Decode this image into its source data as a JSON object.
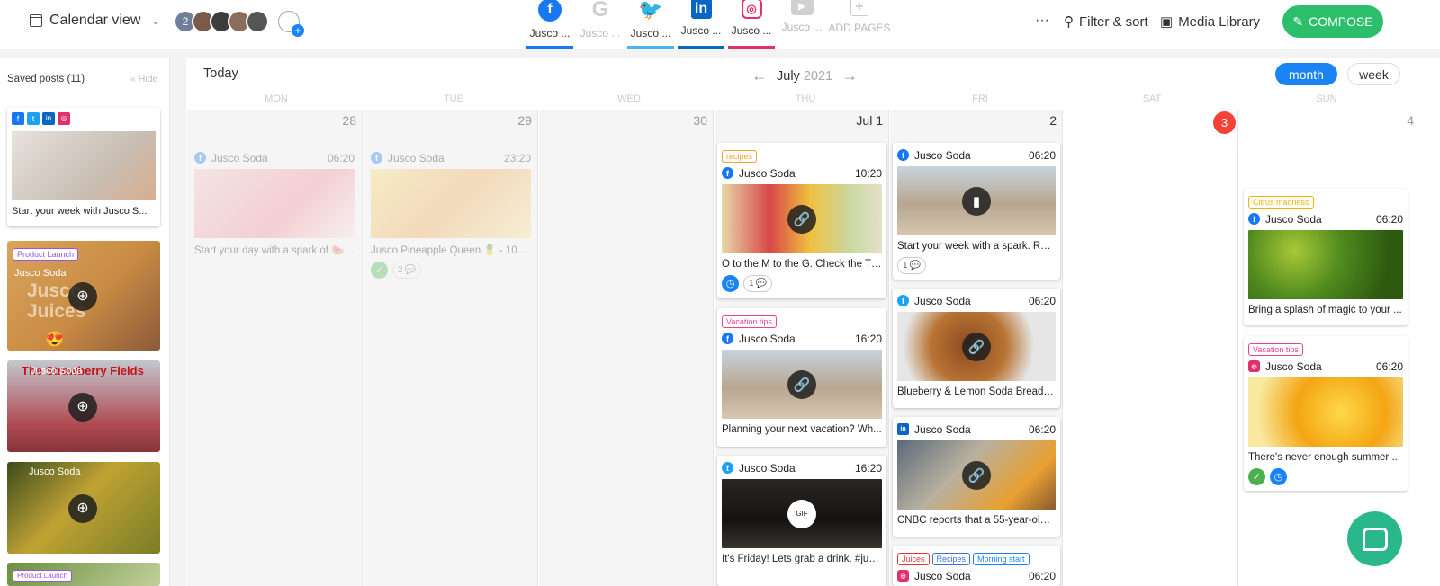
{
  "header": {
    "calendar_view_label": "Calendar view",
    "team_count": "2",
    "tabs": [
      {
        "label": "Jusco ...",
        "icon": "facebook-icon",
        "glyph": "f",
        "color": "#1877f2",
        "active": true,
        "bar": "#1877f2"
      },
      {
        "label": "Jusco ...",
        "icon": "google-icon",
        "glyph": "G",
        "color": "#cfcfcf",
        "active": false,
        "bar": ""
      },
      {
        "label": "Jusco ...",
        "icon": "twitter-icon",
        "glyph": "t",
        "color": "#1da1f2",
        "active": true,
        "bar": "#4fb2f0"
      },
      {
        "label": "Jusco ...",
        "icon": "linkedin-icon",
        "glyph": "in",
        "color": "#0a66c2",
        "active": true,
        "bar": "#0a66c2"
      },
      {
        "label": "Jusco ...",
        "icon": "instagram-icon",
        "glyph": "◎",
        "color": "#e1306c",
        "active": true,
        "bar": "#e1306c"
      },
      {
        "label": "Jusco ...",
        "icon": "youtube-icon",
        "glyph": "▶",
        "color": "#cfcfcf",
        "active": false,
        "bar": ""
      },
      {
        "label": "ADD PAGES",
        "icon": "add-pages-icon",
        "glyph": "+",
        "color": "#cfcfcf",
        "active": false,
        "bar": ""
      }
    ],
    "more_label": "···",
    "filter_sort_label": "Filter & sort",
    "media_library_label": "Media Library",
    "compose_label": "COMPOSE"
  },
  "sidebar": {
    "title": "Saved posts (11)",
    "hide_label": "Hide",
    "first_post_caption": "Start your week with Jusco S...",
    "saved": [
      {
        "tag": "Product Launch",
        "account": "Jusco Soda",
        "overlay_text": "Jusco Juices",
        "emoji": "😍"
      },
      {
        "account": "Jusco Soda",
        "overlay_text": "The Strawberry Fields"
      },
      {
        "account": "Jusco Soda"
      },
      {
        "tag": "Product Launch"
      }
    ]
  },
  "calendar": {
    "today_label": "Today",
    "month": "July",
    "year": "2021",
    "view_month": "month",
    "view_week": "week",
    "weekdays": [
      "MON",
      "TUE",
      "WED",
      "THU",
      "FRI",
      "SAT",
      "SUN"
    ],
    "days": [
      "28",
      "29",
      "30",
      "Jul 1",
      "2",
      "3",
      "4"
    ],
    "posts": {
      "mon": {
        "account": "Jusco Soda",
        "time": "06:20",
        "caption": "Start your day with a spark of 🍉 ..."
      },
      "tue": {
        "account": "Jusco Soda",
        "time": "23:20",
        "caption": "Jusco Pineapple Queen 🍍 - 100...",
        "comments": "2"
      },
      "thu": [
        {
          "tag": "recipes",
          "account": "Jusco Soda",
          "time": "10:20",
          "caption": "O to the M to the G. Check the Th...",
          "comments": "1"
        },
        {
          "tag": "Vacation tips",
          "account": "Jusco Soda",
          "time": "16:20",
          "caption": "Planning your next vacation? Wh..."
        },
        {
          "account": "Jusco Soda",
          "time": "16:20",
          "caption": "It's Friday! Lets grab a drink. #jus..."
        }
      ],
      "fri": [
        {
          "account": "Jusco Soda",
          "time": "06:20",
          "caption": "Start your week with a spark. Rea...",
          "comments": "1"
        },
        {
          "account": "Jusco Soda",
          "time": "06:20",
          "caption": "Blueberry & Lemon Soda Bread –..."
        },
        {
          "account": "Jusco Soda",
          "time": "06:20",
          "caption": "CNBC reports that a 55-year-old ..."
        },
        {
          "tags": [
            "Juices",
            "Recipes",
            "Morning start"
          ],
          "account": "Jusco Soda",
          "time": "06:20"
        }
      ],
      "sun": [
        {
          "tag": "Citrus madness",
          "account": "Jusco Soda",
          "time": "06:20",
          "caption": "Bring a splash of magic to your ..."
        },
        {
          "tag": "Vacation tips",
          "account": "Jusco Soda",
          "time": "06:20",
          "caption": "There's never enough summer ..."
        }
      ]
    }
  }
}
